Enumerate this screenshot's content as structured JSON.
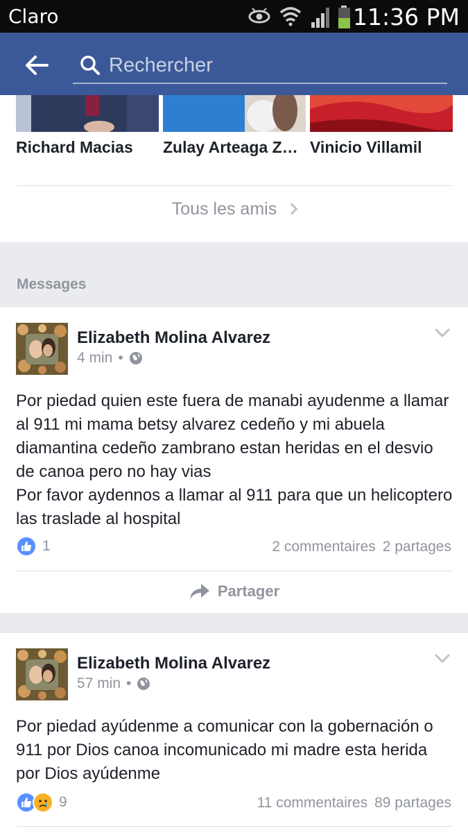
{
  "status_bar": {
    "carrier": "Claro",
    "time": "11:36 PM",
    "icons": [
      "eye-icon",
      "wifi-icon",
      "signal-icon",
      "battery-icon"
    ]
  },
  "appbar": {
    "search_placeholder": "Rechercher",
    "icons": [
      "back-arrow-icon",
      "search-icon"
    ],
    "color": "#3b5998"
  },
  "friends": {
    "items": [
      {
        "name": "Richard Macias"
      },
      {
        "name": "Zulay Arteaga Za…"
      },
      {
        "name": "Vinicio Villamil"
      }
    ],
    "all_friends_label": "Tous les amis"
  },
  "messages_section": {
    "label": "Messages"
  },
  "posts": [
    {
      "author": "Elizabeth Molina Alvarez",
      "time": "4 min",
      "separator": "•",
      "text": "Por piedad quien este fuera de manabi ayudenme a llamar al 911 mi mama betsy alvarez cedeño y mi abuela diamantina cedeño zambrano estan heridas en el desvio de canoa pero no hay vias\nPor favor aydennos a llamar al 911 para que un helicoptero las traslade al hospital",
      "reactions": [
        "like"
      ],
      "reaction_count": "1",
      "comments": "2 commentaires",
      "shares": "2 partages",
      "share_label": "Partager"
    },
    {
      "author": "Elizabeth Molina Alvarez",
      "time": "57 min",
      "separator": "•",
      "text": "Por piedad ayúdenme a comunicar con la gobernación o 911 por Dios canoa incomunicado mi madre esta herida por Dios ayúdenme",
      "reactions": [
        "like",
        "sad"
      ],
      "reaction_count": "9",
      "comments": "11 commentaires",
      "shares": "89 partages"
    }
  ]
}
